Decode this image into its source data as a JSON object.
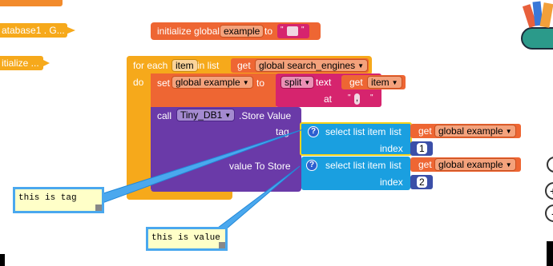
{
  "colors": {
    "orange": "#f28b2c",
    "init_orange": "#ee6633",
    "loop_yellow": "#f6a91b",
    "procedure_red": "#ee6633",
    "text_pink": "#d6246e",
    "tinydb_purple": "#6a3aa8",
    "list_blue": "#1a9fe0",
    "math_navy": "#3b4fa8",
    "comment_bg": "#ffffc8"
  },
  "left_partial_blocks": {
    "top": "...",
    "database": "atabase1 . G...",
    "initialize": "itialize ..."
  },
  "init_block": {
    "label": "initialize global",
    "var_name": "example",
    "to": "to",
    "value_open": "\"",
    "value_close": "\""
  },
  "foreach": {
    "for_each": "for each",
    "item_var": "item",
    "in_list": "in list",
    "do": "do",
    "get_label": "get",
    "list_var": "global search_engines"
  },
  "set_block": {
    "set": "set",
    "var": "global example",
    "to": "to",
    "split": "split",
    "text": "text",
    "at": "at",
    "get": "get",
    "get_var": "item",
    "at_value": ","
  },
  "store_block": {
    "call": "call",
    "component": "Tiny_DB1",
    "method": ".Store Value",
    "tag": "tag",
    "value_to_store": "value To Store"
  },
  "select1": {
    "label": "select list item",
    "list": "list",
    "index": "index",
    "get": "get",
    "var": "global example",
    "index_value": "1"
  },
  "select2": {
    "label": "select list item",
    "list": "list",
    "index": "index",
    "get": "get",
    "var": "global example",
    "index_value": "2"
  },
  "comments": {
    "tag_comment": "this is tag",
    "value_comment": "this is value"
  },
  "icons": {
    "question": "?",
    "zoom_center": "target-icon",
    "zoom_in": "+",
    "zoom_out": "-"
  }
}
